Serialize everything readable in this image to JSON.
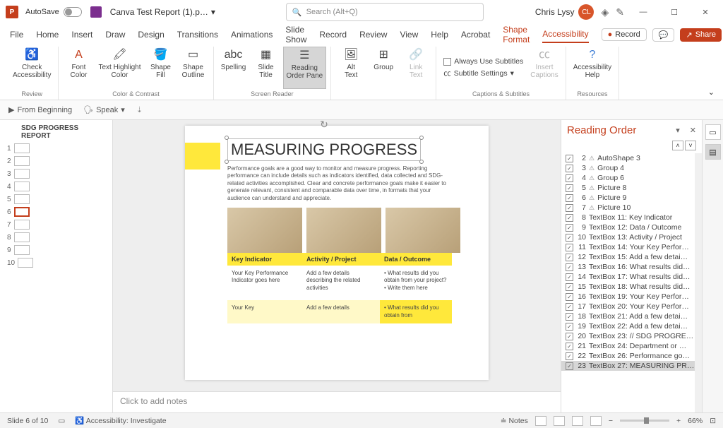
{
  "titlebar": {
    "autosave_label": "AutoSave",
    "doc_title": "Canva Test Report (1).p…",
    "search_placeholder": "Search (Alt+Q)",
    "user_name": "Chris Lysy",
    "user_initials": "CL"
  },
  "tabs": {
    "items": [
      "File",
      "Home",
      "Insert",
      "Draw",
      "Design",
      "Transitions",
      "Animations",
      "Slide Show",
      "Record",
      "Review",
      "View",
      "Help",
      "Acrobat",
      "Shape Format",
      "Accessibility"
    ],
    "record_label": "Record",
    "share_label": "Share"
  },
  "ribbon": {
    "check": "Check\nAccessibility",
    "fontcolor": "Font\nColor",
    "highlight": "Text Highlight\nColor",
    "shapefill": "Shape\nFill",
    "shapeoutline": "Shape\nOutline",
    "spelling": "Spelling",
    "slidetitle": "Slide\nTitle",
    "readingorder": "Reading\nOrder Pane",
    "alttext": "Alt\nText",
    "group": "Group",
    "linktext": "Link\nText",
    "alwayssubs": "Always Use Subtitles",
    "subsettings": "Subtitle Settings",
    "insertcaptions": "Insert\nCaptions",
    "a11yhelp": "Accessibility\nHelp",
    "g_review": "Review",
    "g_color": "Color & Contrast",
    "g_screen": "Screen Reader",
    "g_captions": "Captions & Subtitles",
    "g_resources": "Resources"
  },
  "subribbon": {
    "from_beginning": "From Beginning",
    "speak": "Speak"
  },
  "thumbs": {
    "title": "SDG PROGRESS REPORT",
    "count": 10,
    "selected": 6
  },
  "slide": {
    "title": "MEASURING PROGRESS",
    "para": "Performance goals are a good way to monitor and measure progress. Reporting performance can include details such as indicators identified, data collected and SDG-related activities accomplished. Clear and concrete performance goals make it easier to generate relevant, consistent and comparable data over time, in formats that your audience can understand and appreciate.",
    "h1": "Key Indicator",
    "h2": "Activity / Project",
    "h3": "Data / Outcome",
    "c1a": "Your Key Performance Indicator goes here",
    "c2a": "Add a few details describing the related activities",
    "c3a": "• What results did you obtain from your project?\n• Write them here",
    "c1b": "Your Key",
    "c2b": "Add a few details",
    "c3b": "• What results did you obtain from"
  },
  "pane": {
    "title": "Reading Order",
    "items": [
      {
        "n": "2",
        "warn": true,
        "label": "AutoShape 3"
      },
      {
        "n": "3",
        "warn": true,
        "label": "Group 4"
      },
      {
        "n": "4",
        "warn": true,
        "label": "Group 6"
      },
      {
        "n": "5",
        "warn": true,
        "label": "Picture 8"
      },
      {
        "n": "6",
        "warn": true,
        "label": "Picture 9"
      },
      {
        "n": "7",
        "warn": true,
        "label": "Picture 10"
      },
      {
        "n": "8",
        "warn": false,
        "label": "TextBox 11: Key Indicator"
      },
      {
        "n": "9",
        "warn": false,
        "label": "TextBox 12: Data / Outcome"
      },
      {
        "n": "10",
        "warn": false,
        "label": "TextBox 13: Activity / Project"
      },
      {
        "n": "11",
        "warn": false,
        "label": "TextBox 14: Your Key Perfor…"
      },
      {
        "n": "12",
        "warn": false,
        "label": "TextBox 15: Add a few detai…"
      },
      {
        "n": "13",
        "warn": false,
        "label": "TextBox 16: What results did…"
      },
      {
        "n": "14",
        "warn": false,
        "label": "TextBox 17: What results did…"
      },
      {
        "n": "15",
        "warn": false,
        "label": "TextBox 18: What results did…"
      },
      {
        "n": "16",
        "warn": false,
        "label": "TextBox 19: Your Key Perfor…"
      },
      {
        "n": "17",
        "warn": false,
        "label": "TextBox 20: Your Key Perfor…"
      },
      {
        "n": "18",
        "warn": false,
        "label": "TextBox 21: Add a few detai…"
      },
      {
        "n": "19",
        "warn": false,
        "label": "TextBox 22: Add a few detai…"
      },
      {
        "n": "20",
        "warn": false,
        "label": "TextBox 23: // SDG PROGRE…"
      },
      {
        "n": "21",
        "warn": false,
        "label": "TextBox 24: Department or …"
      },
      {
        "n": "22",
        "warn": false,
        "label": "TextBox 26: Performance go…"
      },
      {
        "n": "23",
        "warn": false,
        "label": "TextBox 27: MEASURING PR…",
        "sel": true
      }
    ]
  },
  "notes": {
    "placeholder": "Click to add notes"
  },
  "status": {
    "slide": "Slide 6 of 10",
    "a11y": "Accessibility: Investigate",
    "notes_btn": "Notes",
    "zoom": "66%"
  }
}
